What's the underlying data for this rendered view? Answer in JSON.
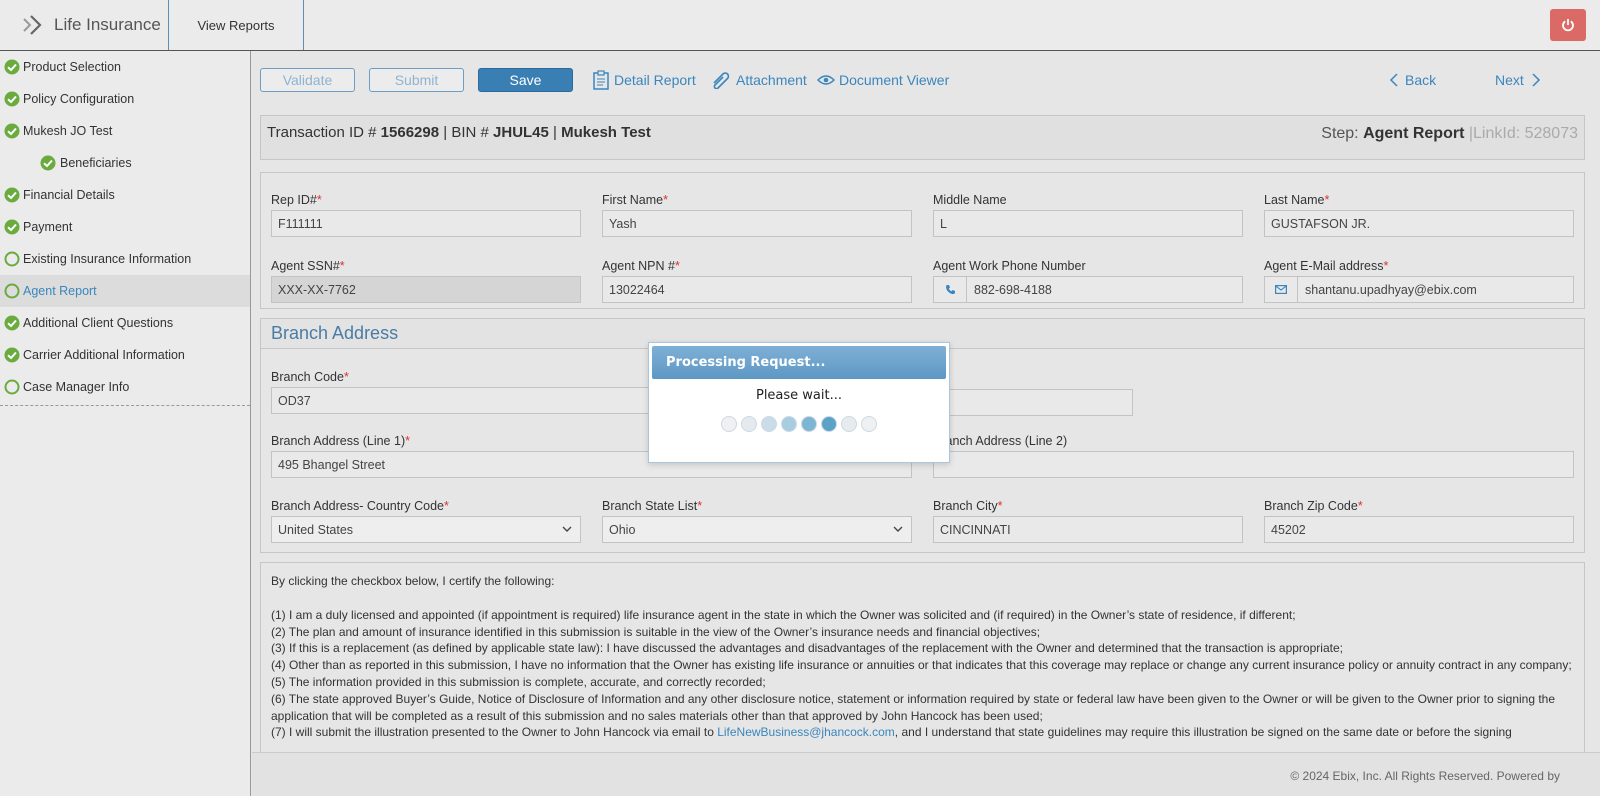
{
  "header": {
    "app_name": "Life Insurance",
    "view_reports": "View Reports",
    "power_icon": "power-icon",
    "power_color": "#d9534f"
  },
  "sidebar": {
    "items": [
      {
        "label": "Product Selection",
        "status": "complete"
      },
      {
        "label": "Policy Configuration",
        "status": "complete"
      },
      {
        "label": "Mukesh JO Test",
        "status": "complete"
      },
      {
        "label": "Beneficiaries",
        "status": "complete"
      },
      {
        "label": "Financial Details",
        "status": "complete"
      },
      {
        "label": "Payment",
        "status": "complete"
      },
      {
        "label": "Existing Insurance Information",
        "status": "incomplete"
      },
      {
        "label": "Agent Report",
        "status": "incomplete"
      },
      {
        "label": "Additional Client Questions",
        "status": "complete"
      },
      {
        "label": "Carrier Additional Information",
        "status": "complete"
      },
      {
        "label": "Case Manager Info",
        "status": "incomplete"
      }
    ]
  },
  "toolbar": {
    "validate": "Validate",
    "submit": "Submit",
    "save": "Save",
    "detail_report": "Detail Report",
    "attachment": "Attachment",
    "document_viewer": "Document Viewer",
    "back": "Back",
    "next": "Next"
  },
  "info": {
    "transaction_label": "Transaction ID #",
    "transaction_id": "1566298",
    "bin_label": "| BIN #",
    "bin": "JHUL45",
    "sep": "|",
    "name": "Mukesh Test",
    "step_label": "Step:",
    "step": "Agent Report",
    "linkid": "|LinkId: 528073"
  },
  "agent": {
    "rep_id_label": "Rep ID#",
    "rep_id": "F111111",
    "first_name_label": "First Name",
    "first_name": "Yash",
    "middle_name_label": "Middle Name",
    "middle_name": "L",
    "last_name_label": "Last Name",
    "last_name": "GUSTAFSON JR.",
    "ssn_label": "Agent SSN#",
    "ssn": "XXX-XX-7762",
    "npn_label": "Agent NPN #",
    "npn": "13022464",
    "phone_label": "Agent Work Phone Number",
    "phone": "882-698-4188",
    "email_label": "Agent E-Mail address",
    "email": "shantanu.upadhyay@ebix.com",
    "required_mark": "*"
  },
  "branch": {
    "title": "Branch Address",
    "code_label": "Branch Code",
    "code": "OD37",
    "line1_label": "Branch Address (Line 1)",
    "line1": "495 Bhangel Street",
    "line2_label": "Branch Address (Line 2)",
    "line2": "",
    "country_label": "Branch Address- Country Code",
    "country": "United States",
    "state_label": "Branch State List",
    "state": "Ohio",
    "city_label": "Branch City",
    "city": "CINCINNATI",
    "zip_label": "Branch Zip Code",
    "zip": "45202"
  },
  "certification": {
    "intro": "By clicking the checkbox below, I certify the following:",
    "items": [
      "(1) I am a duly licensed and appointed (if appointment is required) life insurance agent in the state in which the Owner was solicited and (if required) in the Owner’s state of residence, if different;",
      "(2) The plan and amount of insurance identified in this submission is suitable in the view of the Owner’s insurance needs and financial objectives;",
      "(3) If this is a replacement (as defined by applicable state law): I have discussed the advantages and disadvantages of the replacement with the Owner and determined that the transaction is appropriate;",
      "(4) Other than as reported in this submission, I have no information that the Owner has existing life insurance or annuities or that indicates that this coverage may replace or change any current insurance policy or annuity contract in any company;",
      "(5) The information provided in this submission is complete, accurate, and correctly recorded;",
      "(6) The state approved Buyer’s Guide, Notice of Disclosure of Information and any other disclosure notice, statement or information required by state or federal law have been given to the Owner or will be given to the Owner prior to signing the application that will be completed as a result of this submission and no sales materials other than that approved by John Hancock has been used;"
    ],
    "item7_start": "(7) I will submit the illustration presented to the Owner to John Hancock via email to ",
    "item7_link": "LifeNewBusiness@jhancock.com",
    "item7_end": ", and I understand that state guidelines may require this illustration be signed on the same date or before the signing"
  },
  "footer": {
    "text": "© 2024 Ebix, Inc. All Rights Reserved. Powered by"
  },
  "modal": {
    "title": "Processing Request...",
    "message": "Please wait...",
    "dot_colors": [
      "#eef0f2",
      "#e4eaee",
      "#c9dde8",
      "#a8cde0",
      "#7cb6d3",
      "#5aa3c7",
      "#e6ebee",
      "#eef0f2"
    ]
  },
  "colors": {
    "accent": "#3a86bd",
    "check_green": "#6bab3e",
    "required": "#d33"
  }
}
